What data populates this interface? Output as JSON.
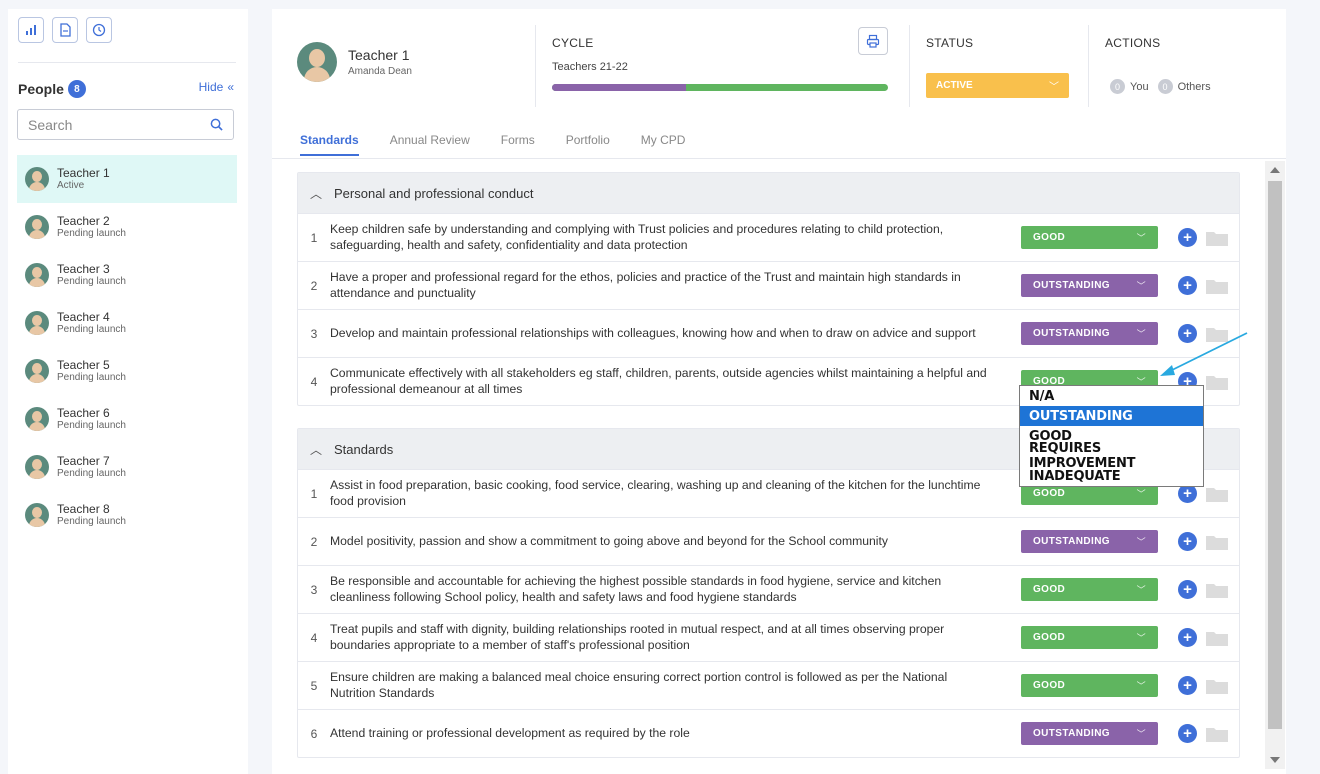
{
  "sidebar": {
    "people_label": "People",
    "people_count": "8",
    "hide_label": "Hide",
    "search_placeholder": "Search",
    "people": [
      {
        "name": "Teacher 1",
        "status": "Active"
      },
      {
        "name": "Teacher 2",
        "status": "Pending launch"
      },
      {
        "name": "Teacher 3",
        "status": "Pending launch"
      },
      {
        "name": "Teacher 4",
        "status": "Pending launch"
      },
      {
        "name": "Teacher 5",
        "status": "Pending launch"
      },
      {
        "name": "Teacher 6",
        "status": "Pending launch"
      },
      {
        "name": "Teacher 7",
        "status": "Pending launch"
      },
      {
        "name": "Teacher 8",
        "status": "Pending launch"
      }
    ]
  },
  "header": {
    "name": "Teacher 1",
    "subname": "Amanda Dean",
    "cycle_label": "CYCLE",
    "cycle_value": "Teachers 21-22",
    "cycle_progress": 0.4,
    "status_label": "STATUS",
    "status_value": "ACTIVE",
    "actions_label": "ACTIONS",
    "you_count": "0",
    "you_label": "You",
    "others_count": "0",
    "others_label": "Others"
  },
  "tabs": [
    "Standards",
    "Annual Review",
    "Forms",
    "Portfolio",
    "My CPD"
  ],
  "colors": {
    "good": "#5fb55f",
    "outstanding": "#8a63a9",
    "status": "#f9c04c",
    "accent": "#3f6fd8"
  },
  "sections": [
    {
      "title": "Personal and professional conduct",
      "items": [
        {
          "num": "1",
          "text": "Keep children safe by understanding and complying with Trust policies and procedures relating to child protection, safeguarding, health and safety, confidentiality and data protection",
          "rating": "GOOD"
        },
        {
          "num": "2",
          "text": "Have a proper and professional regard for the ethos, policies and practice of the Trust and maintain high standards in attendance and punctuality",
          "rating": "OUTSTANDING"
        },
        {
          "num": "3",
          "text": "Develop and maintain professional relationships with colleagues, knowing how and when to draw on advice and support",
          "rating": "OUTSTANDING"
        },
        {
          "num": "4",
          "text": "Communicate effectively with all stakeholders eg staff, children, parents, outside agencies whilst maintaining a helpful and professional demeanour at all times",
          "rating": "GOOD"
        }
      ]
    },
    {
      "title": "Standards",
      "items": [
        {
          "num": "1",
          "text": "Assist in food preparation, basic cooking, food service, clearing, washing up and cleaning of the kitchen for the lunchtime food provision",
          "rating": "GOOD"
        },
        {
          "num": "2",
          "text": "Model positivity, passion and show a commitment to going above and beyond for the School community",
          "rating": "OUTSTANDING"
        },
        {
          "num": "3",
          "text": "Be responsible and accountable for achieving the highest possible standards in food hygiene, service and kitchen cleanliness following School policy, health and safety laws and food hygiene standards",
          "rating": "GOOD"
        },
        {
          "num": "4",
          "text": "Treat pupils and staff with dignity, building relationships rooted in mutual respect, and at all times observing proper boundaries appropriate to a member of staff's professional position",
          "rating": "GOOD"
        },
        {
          "num": "5",
          "text": "Ensure children are making a balanced meal choice ensuring correct portion control is followed as per the National Nutrition Standards",
          "rating": "GOOD"
        },
        {
          "num": "6",
          "text": "Attend training or professional development as required by the role",
          "rating": "OUTSTANDING"
        }
      ]
    }
  ],
  "dropdown": {
    "options": [
      "N/A",
      "OUTSTANDING",
      "GOOD",
      "REQUIRES IMPROVEMENT",
      "INADEQUATE"
    ],
    "highlighted": "OUTSTANDING"
  }
}
